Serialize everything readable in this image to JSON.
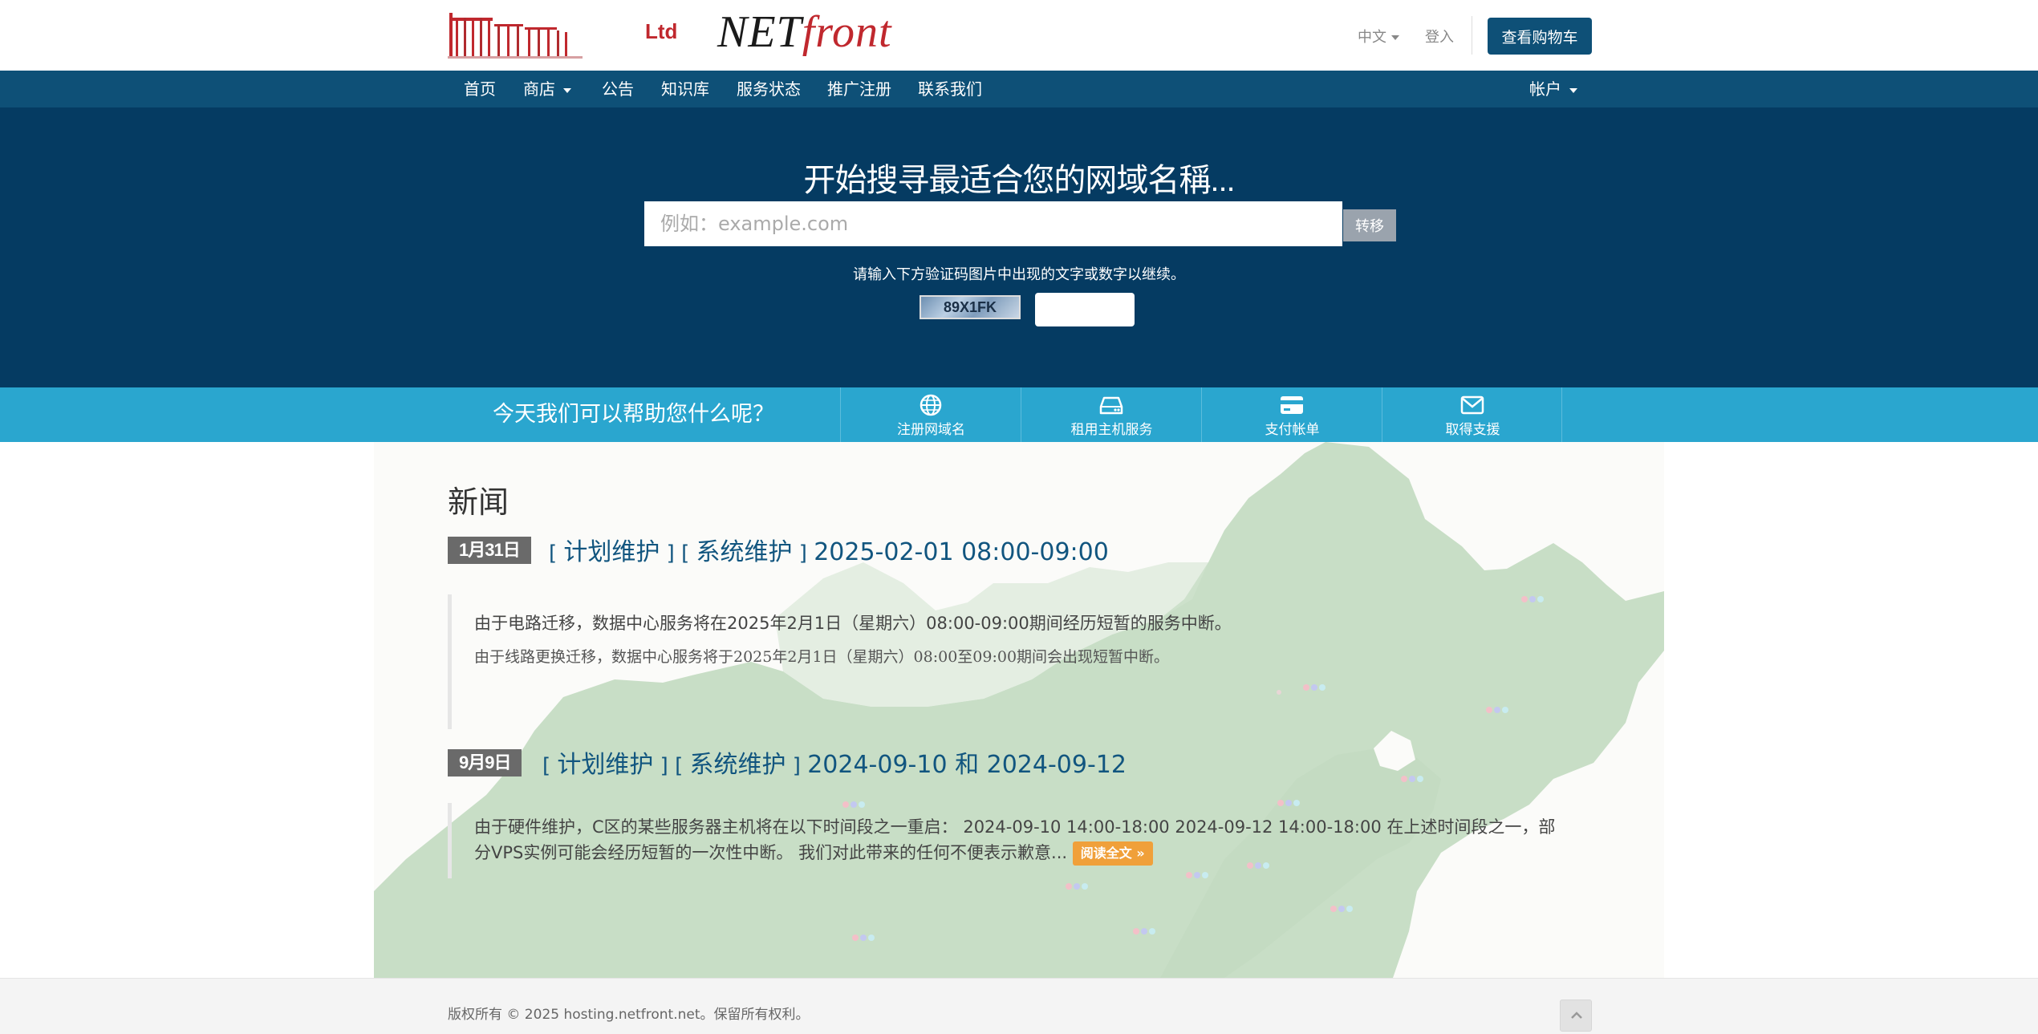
{
  "header": {
    "logo_ltd": "Ltd",
    "logo_net": "NET",
    "logo_front": "front",
    "language": "中文",
    "login": "登入",
    "cart_button": "查看购物车"
  },
  "nav": {
    "items": [
      {
        "label": "首页"
      },
      {
        "label": "商店"
      },
      {
        "label": "公告"
      },
      {
        "label": "知识库"
      },
      {
        "label": "服务状态"
      },
      {
        "label": "推广注册"
      },
      {
        "label": "联系我们"
      }
    ],
    "account": "帐户"
  },
  "domain_search": {
    "title": "开始搜寻最适合您的网域名稱...",
    "placeholder": "例如：example.com",
    "transfer_button": "转移",
    "captcha_hint": "请输入下方验证码图片中出现的文字或数字以继续。",
    "captcha_code": "89X1FK"
  },
  "help": {
    "text": "今天我们可以帮助您什么呢？",
    "items": [
      {
        "icon": "globe-icon",
        "label": "注册网域名"
      },
      {
        "icon": "server-icon",
        "label": "租用主机服务"
      },
      {
        "icon": "credit-card-icon",
        "label": "支付帐单"
      },
      {
        "icon": "envelope-icon",
        "label": "取得支援"
      }
    ]
  },
  "news": {
    "heading": "新闻",
    "items": [
      {
        "date": "1月31日",
        "tag1": "计划维护",
        "tag2": "系统维护",
        "time": "2025-02-01 08:00-09:00",
        "body1": "由于电路迁移，数据中心服务将在2025年2月1日（星期六）08:00-09:00期间经历短暂的服务中断。",
        "body2": "由于线路更换迁移，数据中心服务将于2025年2月1日（星期六）08:00至09:00期间会出现短暂中断。"
      },
      {
        "date": "9月9日",
        "tag1": "计划维护",
        "tag2": "系统维护",
        "time": "2024-09-10 和 2024-09-12",
        "body1": "由于硬件维护，C区的某些服务器主机将在以下时间段之一重启：  2024-09-10 14:00-18:00 2024-09-12 14:00-18:00 在上述时间段之一，部分VPS实例可能会经历短暂的一次性中断。 我们对此带来的任何不便表示歉意...",
        "read_more": "阅读全文 »"
      }
    ]
  },
  "footer": {
    "copyright": "版权所有 © 2025 hosting.netfront.net。保留所有权利。"
  },
  "colors": {
    "nav": "#0e5077",
    "hero": "#053b62",
    "help_strip": "#2aa6cf",
    "accent_orange": "#f0a03a",
    "logo_red": "#c0282e"
  }
}
